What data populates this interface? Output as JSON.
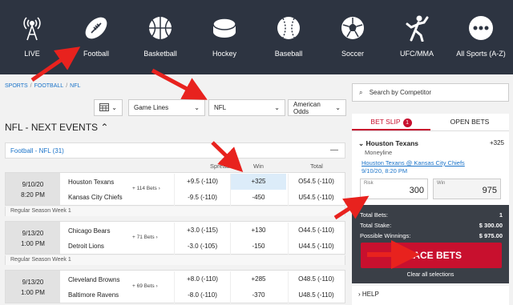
{
  "nav": [
    {
      "label": "LIVE",
      "icon": "live-antenna-icon"
    },
    {
      "label": "Football",
      "icon": "football-icon"
    },
    {
      "label": "Basketball",
      "icon": "basketball-icon"
    },
    {
      "label": "Hockey",
      "icon": "hockey-puck-icon"
    },
    {
      "label": "Baseball",
      "icon": "baseball-icon"
    },
    {
      "label": "Soccer",
      "icon": "soccer-ball-icon"
    },
    {
      "label": "UFC/MMA",
      "icon": "fighter-icon"
    },
    {
      "label": "All Sports (A-Z)",
      "icon": "more-dots-icon"
    }
  ],
  "breadcrumb": [
    "SPORTS",
    "FOOTBALL",
    "NFL"
  ],
  "filters": {
    "market": "Game Lines",
    "league": "NFL",
    "odds": "American Odds"
  },
  "title": "NFL - NEXT EVENTS",
  "league_header": "Football - NFL (31)",
  "columns": [
    "Spread",
    "Win",
    "Total"
  ],
  "games": [
    {
      "date": "9/10/20",
      "time": "8:20 PM",
      "home": "Houston Texans",
      "away": "Kansas City Chiefs",
      "bets": "+ 114 Bets",
      "spread": [
        "+9.5 (-110)",
        "-9.5 (-110)"
      ],
      "win": [
        "+325",
        "-450"
      ],
      "total": [
        "O54.5 (-110)",
        "U54.5 (-110)"
      ],
      "week": "Regular Season Week 1"
    },
    {
      "date": "9/13/20",
      "time": "1:00 PM",
      "home": "Chicago Bears",
      "away": "Detroit Lions",
      "bets": "+ 71 Bets",
      "spread": [
        "+3.0 (-115)",
        "-3.0 (-105)"
      ],
      "win": [
        "+130",
        "-150"
      ],
      "total": [
        "O44.5 (-110)",
        "U44.5 (-110)"
      ],
      "week": "Regular Season Week 1"
    },
    {
      "date": "9/13/20",
      "time": "1:00 PM",
      "home": "Cleveland Browns",
      "away": "Baltimore Ravens",
      "bets": "+ 69 Bets",
      "spread": [
        "+8.0 (-110)",
        "-8.0 (-110)"
      ],
      "win": [
        "+285",
        "-370"
      ],
      "total": [
        "O48.5 (-110)",
        "U48.5 (-110)"
      ],
      "week": ""
    }
  ],
  "search_placeholder": "Search by Competitor",
  "tabs": {
    "betslip": "BET SLIP",
    "count": "1",
    "open": "OPEN BETS"
  },
  "slip": {
    "team": "Houston Texans",
    "market": "Moneyline",
    "odds": "+325",
    "match": "Houston Texans @ Kansas City Chiefs",
    "datetime": "9/10/20, 8:20 PM",
    "risk_label": "Risk",
    "risk": "300",
    "win_label": "Win",
    "win": "975"
  },
  "totals": {
    "bets_label": "Total Bets:",
    "bets": "1",
    "stake_label": "Total Stake:",
    "stake": "$ 300.00",
    "winnings_label": "Possible Winnings:",
    "winnings": "$ 975.00"
  },
  "place_label": "PLACE BETS",
  "clear_label": "Clear all selections",
  "help_label": "HELP"
}
